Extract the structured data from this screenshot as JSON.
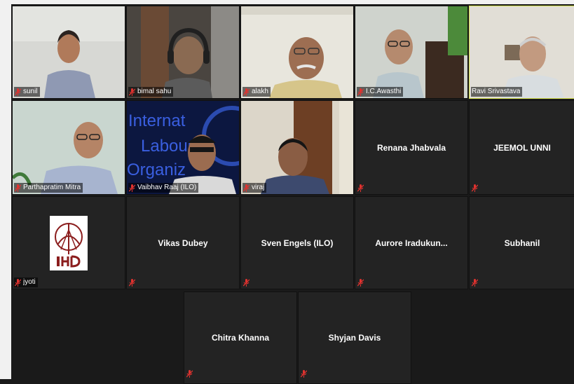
{
  "meeting": {
    "tiles": [
      {
        "name": "sunil",
        "type": "video",
        "bg": "#d7d8d4",
        "shirt": "#8f99b3",
        "skin": "#b07a5a"
      },
      {
        "name": "bimal sahu",
        "type": "video",
        "bg": "#4a4540",
        "shirt": "#6b6b6b",
        "skin": "#8a6a52"
      },
      {
        "name": "alakh",
        "type": "video",
        "bg": "#e8e6dd",
        "shirt": "#d6c58a",
        "skin": "#9d6e52"
      },
      {
        "name": "I.C.Awasthi",
        "type": "video",
        "bg": "#cfd3cd",
        "shirt": "#b8c6cc",
        "skin": "#b58a6e"
      },
      {
        "name": "Ravi Srivastava",
        "type": "video",
        "bg": "#e1ded6",
        "shirt": "#d8dde0",
        "skin": "#c29a80",
        "active": true
      },
      {
        "name": "Parthapratim Mitra",
        "type": "video",
        "bg": "#c9d6cf",
        "shirt": "#a7b4cf",
        "skin": "#b58466"
      },
      {
        "name": "Vaibhav Raaj (ILO)",
        "type": "video",
        "bg": "#0c1740",
        "shirt": "#d9d9d9",
        "skin": "#9b6c50",
        "overlay_text": [
          "Internat",
          "Labour",
          "Organiz"
        ]
      },
      {
        "name": "viraj",
        "type": "video",
        "bg": "#dcd6c9",
        "shirt": "#3d4a6e",
        "skin": "#8a5d44"
      },
      {
        "name": "Renana Jhabvala",
        "type": "name"
      },
      {
        "name": "JEEMOL UNNI",
        "type": "name"
      },
      {
        "name": "jyoti",
        "type": "logo"
      },
      {
        "name": "Vikas Dubey",
        "type": "name"
      },
      {
        "name": "Sven Engels (ILO)",
        "type": "name"
      },
      {
        "name": "Aurore Iradukun...",
        "type": "name"
      },
      {
        "name": "Subhanil",
        "type": "name"
      },
      {
        "name": "Chitra Khanna",
        "type": "name"
      },
      {
        "name": "Shyjan Davis",
        "type": "name"
      }
    ]
  },
  "colors": {
    "mute_red": "#e0322f",
    "active_border": "#d4e04a",
    "tile_dark": "#232323"
  }
}
